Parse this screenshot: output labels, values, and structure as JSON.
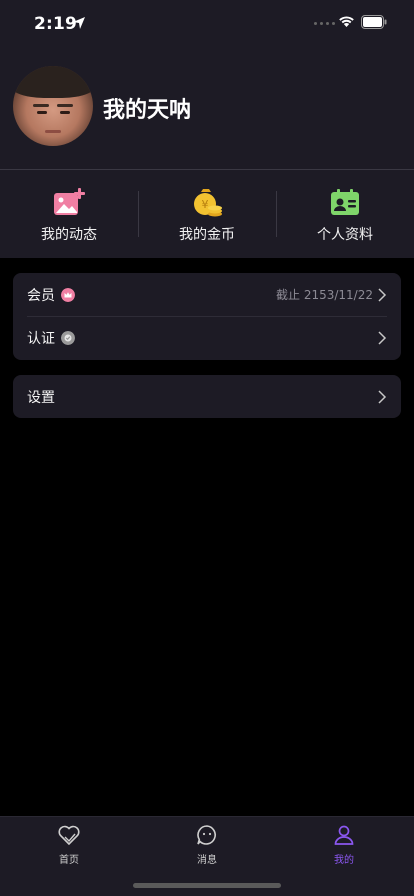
{
  "status_bar": {
    "time": "2:19"
  },
  "profile": {
    "username": "我的天呐"
  },
  "quick_actions": [
    {
      "label": "我的动态",
      "icon": "image-add-icon",
      "color": "#f07fa3"
    },
    {
      "label": "我的金币",
      "icon": "money-bag-icon",
      "color": "#f2c231"
    },
    {
      "label": "个人资料",
      "icon": "id-card-icon",
      "color": "#7fd56a"
    }
  ],
  "menu": {
    "vip": {
      "label": "会员",
      "value": "截止 2153/11/22",
      "badge_color": "#f07fa3"
    },
    "certification": {
      "label": "认证",
      "badge_color": "#9a9a9a"
    },
    "settings": {
      "label": "设置"
    }
  },
  "tab_bar": {
    "tabs": [
      {
        "label": "首页",
        "icon": "heart-icon",
        "active": false
      },
      {
        "label": "消息",
        "icon": "chat-icon",
        "active": false
      },
      {
        "label": "我的",
        "icon": "user-icon",
        "active": true
      }
    ],
    "active_color": "#8b57f0"
  }
}
